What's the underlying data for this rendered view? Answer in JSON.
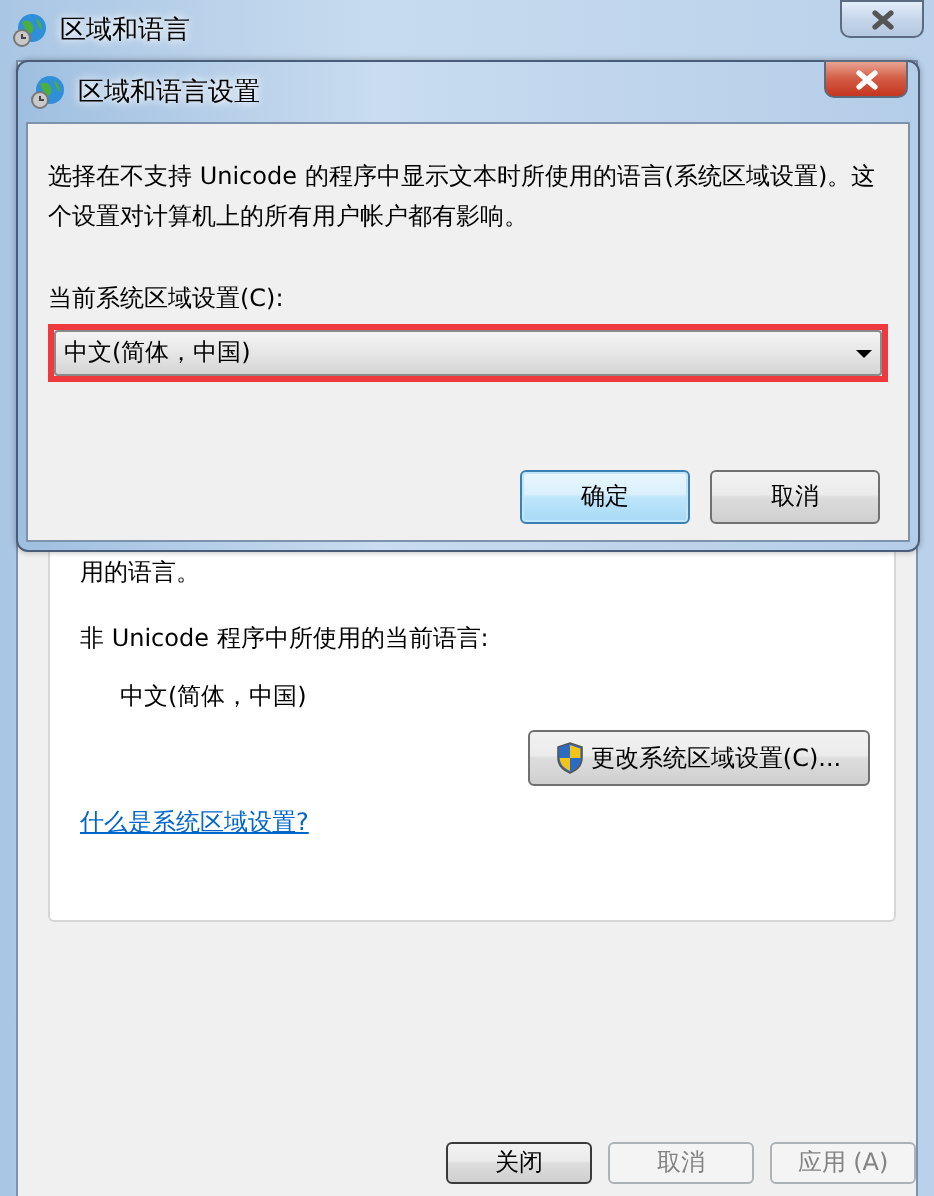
{
  "main_window": {
    "title": "区域和语言",
    "note_tail": "用的语言。",
    "current_language_label": "非 Unicode 程序中所使用的当前语言:",
    "current_language": "中文(简体，中国)",
    "change_button": "更改系统区域设置(C)...",
    "help_link": "什么是系统区域设置?",
    "buttons": [
      {
        "label": "关闭",
        "disabled": false,
        "default": true
      },
      {
        "label": "取消",
        "disabled": true,
        "default": false
      },
      {
        "label": "应用 (A)",
        "disabled": true,
        "default": false
      }
    ]
  },
  "dialog": {
    "title": "区域和语言设置",
    "description": "选择在不支持 Unicode 的程序中显示文本时所使用的语言(系统区域设置)。这个设置对计算机上的所有用户帐户都有影响。",
    "locale_label": "当前系统区域设置(C):",
    "locale_value": "中文(简体，中国)",
    "highlighted": true,
    "buttons": [
      {
        "label": "确定",
        "default": true
      },
      {
        "label": "取消",
        "default": false
      }
    ]
  }
}
